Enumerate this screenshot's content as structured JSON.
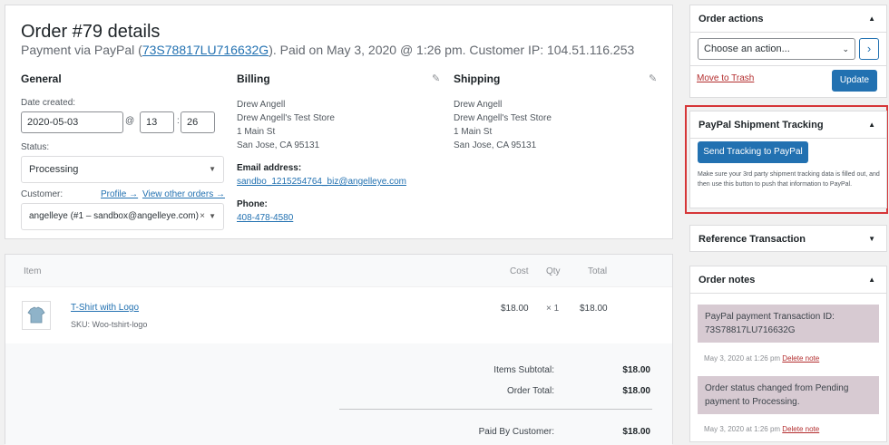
{
  "order": {
    "title": "Order #79 details",
    "sub_prefix": "Payment via PayPal (",
    "txn_id": "73S78817LU716632G",
    "sub_suffix": "). Paid on May 3, 2020 @ 1:26 pm. Customer IP: 104.51.116.253"
  },
  "general": {
    "heading": "General",
    "date_label": "Date created:",
    "date": "2020-05-03",
    "at": "@",
    "hour": "13",
    "minute": "26",
    "status_label": "Status:",
    "status": "Processing",
    "customer_label": "Customer:",
    "profile_link": "Profile →",
    "other_orders_link": "View other orders →",
    "customer": "angelleye (#1 – sandbox@angelleye.com)",
    "clear": "×"
  },
  "billing": {
    "heading": "Billing",
    "name": "Drew Angell",
    "company": "Drew Angell's Test Store",
    "street": "1 Main St",
    "city": "San Jose, CA 95131",
    "email_label": "Email address:",
    "email": "sandbo_1215254764_biz@angelleye.com",
    "phone_label": "Phone:",
    "phone": "408-478-4580"
  },
  "shipping": {
    "heading": "Shipping",
    "name": "Drew Angell",
    "company": "Drew Angell's Test Store",
    "street": "1 Main St",
    "city": "San Jose, CA 95131"
  },
  "items": {
    "headers": {
      "item": "Item",
      "cost": "Cost",
      "qty": "Qty",
      "total": "Total"
    },
    "rows": [
      {
        "name": "T-Shirt with Logo",
        "sku": "SKU: Woo-tshirt-logo",
        "cost": "$18.00",
        "qty": "× 1",
        "total": "$18.00"
      }
    ],
    "subtotal_label": "Items Subtotal:",
    "subtotal": "$18.00",
    "order_total_label": "Order Total:",
    "order_total": "$18.00",
    "paid_label": "Paid By Customer:",
    "paid": "$18.00"
  },
  "order_actions": {
    "title": "Order actions",
    "select_placeholder": "Choose an action...",
    "go": "›",
    "trash": "Move to Trash",
    "update": "Update"
  },
  "paypal_tracking": {
    "title": "PayPal Shipment Tracking",
    "button": "Send Tracking to PayPal",
    "description": "Make sure your 3rd party shipment tracking data is filled out, and then use this button to push that information to PayPal."
  },
  "reference_transaction": {
    "title": "Reference Transaction"
  },
  "order_notes": {
    "title": "Order notes",
    "notes": [
      {
        "text": "PayPal payment Transaction ID: 73S78817LU716632G",
        "meta": "May 3, 2020 at 1:26 pm",
        "delete": "Delete note"
      },
      {
        "text": "Order status changed from Pending payment to Processing.",
        "meta": "May 3, 2020 at 1:26 pm",
        "delete": "Delete note"
      }
    ]
  },
  "colors": {
    "primary": "#2271b1",
    "highlight_border": "#d63638",
    "note_bg": "#d7cad2",
    "danger": "#b32d2e"
  }
}
